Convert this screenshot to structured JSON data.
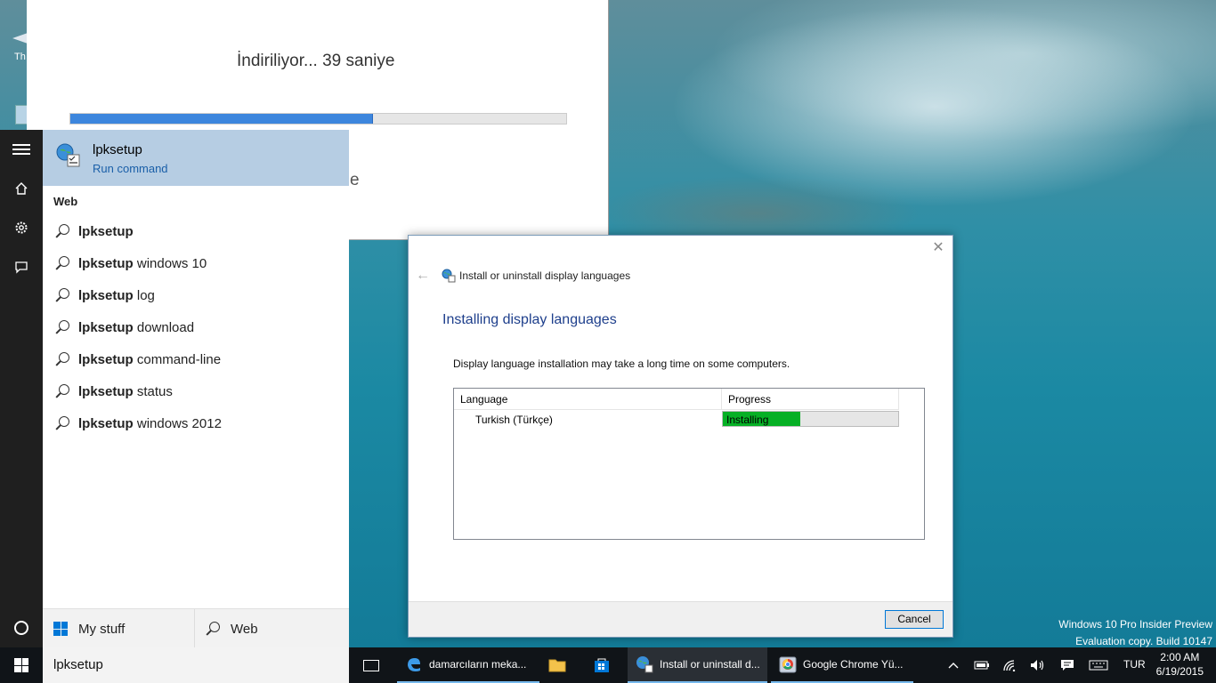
{
  "desktop": {
    "icon_label_partial": "Th"
  },
  "store": {
    "status": "İndiriliyor... 39 saniye",
    "progress": 0.61,
    "partial_text": "e"
  },
  "start": {
    "best_match": {
      "title": "lpksetup",
      "subtitle": "Run command"
    },
    "web_header": "Web",
    "suggestions": [
      {
        "bold": "lpksetup",
        "rest": ""
      },
      {
        "bold": "lpksetup",
        "rest": " windows 10"
      },
      {
        "bold": "lpksetup",
        "rest": " log"
      },
      {
        "bold": "lpksetup",
        "rest": " download"
      },
      {
        "bold": "lpksetup",
        "rest": " command-line"
      },
      {
        "bold": "lpksetup",
        "rest": " status"
      },
      {
        "bold": "lpksetup",
        "rest": " windows 2012"
      }
    ],
    "scope_mystuff": "My stuff",
    "scope_web": "Web",
    "search_query": "lpksetup"
  },
  "dialog": {
    "close_glyph": "✕",
    "back_glyph": "←",
    "nav_title": "Install or uninstall display languages",
    "heading": "Installing display languages",
    "description": "Display language installation may take a long time on some computers.",
    "col_language": "Language",
    "col_progress": "Progress",
    "row_language": "Turkish (Türkçe)",
    "row_status": "Installing",
    "row_progress": 0.44,
    "cancel_label": "Cancel"
  },
  "watermark": {
    "line1": "Windows 10 Pro Insider Preview",
    "line2": "Evaluation copy. Build 10147"
  },
  "taskbar": {
    "items": [
      {
        "label": "damarcıların meka...",
        "icon": "edge-icon"
      },
      {
        "label": "Install or uninstall d...",
        "icon": "globe-icon"
      },
      {
        "label": "Google Chrome Yü...",
        "icon": "chrome-setup-icon"
      }
    ],
    "language": "TUR",
    "time": "2:00 AM",
    "date": "6/19/2015"
  },
  "colors": {
    "accent": "#0078d7",
    "progress_green": "#06b025",
    "store_progress": "#3d86dd",
    "best_match_bg": "#b6cde3",
    "link_blue": "#1a5fa8"
  }
}
